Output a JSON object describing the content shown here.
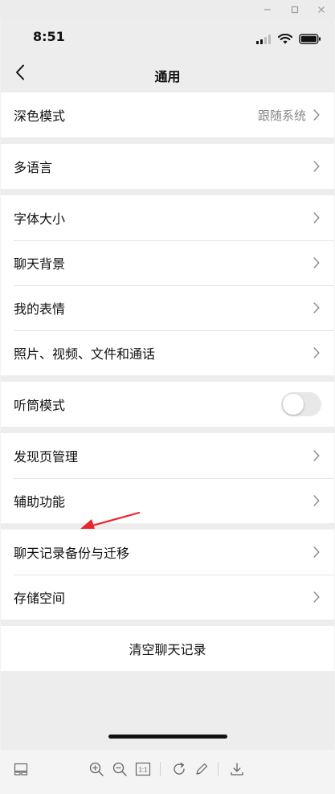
{
  "status": {
    "time": "8:51"
  },
  "nav": {
    "title": "通用",
    "back_icon": "chevron-left-icon"
  },
  "sections": [
    {
      "items": [
        {
          "label": "深色模式",
          "value": "跟随系统"
        }
      ]
    },
    {
      "items": [
        {
          "label": "多语言"
        }
      ]
    },
    {
      "items": [
        {
          "label": "字体大小"
        },
        {
          "label": "聊天背景"
        },
        {
          "label": "我的表情"
        },
        {
          "label": "照片、视频、文件和通话"
        }
      ]
    },
    {
      "items": [
        {
          "label": "听筒模式",
          "toggle_on": false
        }
      ]
    },
    {
      "items": [
        {
          "label": "发现页管理"
        },
        {
          "label": "辅助功能"
        }
      ]
    },
    {
      "items": [
        {
          "label": "聊天记录备份与迁移"
        },
        {
          "label": "存储空间"
        }
      ]
    },
    {
      "items": [
        {
          "label": "清空聊天记录"
        }
      ]
    }
  ],
  "colors": {
    "background": "#ededed",
    "card": "#ffffff",
    "separator": "#e5e5e5",
    "muted_text": "#888888",
    "annotation_arrow": "#e8262b"
  },
  "toolbar": {
    "icons": [
      "thumbnail-icon",
      "zoom-in-icon",
      "zoom-out-icon",
      "actual-size-icon",
      "rotate-icon",
      "edit-icon",
      "download-icon"
    ],
    "actual_size_label": "1:1"
  }
}
